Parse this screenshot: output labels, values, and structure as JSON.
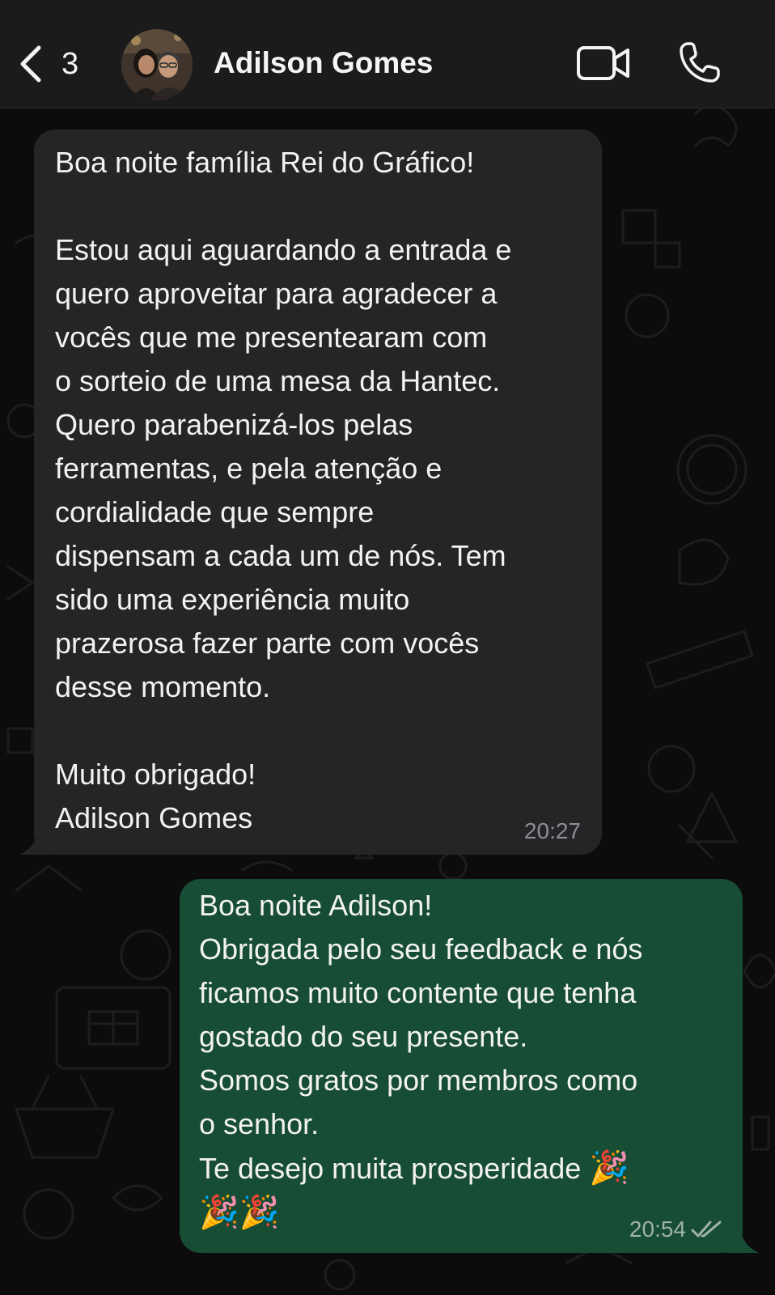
{
  "header": {
    "back_count": "3",
    "contact_name": "Adilson Gomes"
  },
  "messages": [
    {
      "direction": "incoming",
      "text": "Boa noite família Rei do Gráfico!\n\nEstou aqui aguardando a entrada e\nquero aproveitar para agradecer a\nvocês que me presentearam com\no sorteio de uma mesa da Hantec.\nQuero parabenizá-los pelas\nferramentas, e pela atenção e\ncordialidade que sempre\ndispensam a cada um de nós. Tem\nsido uma experiência muito\nprazerosa fazer parte com vocês\ndesse momento.\n\nMuito obrigado!\nAdilson Gomes",
      "time": "20:27"
    },
    {
      "direction": "outgoing",
      "text": "Boa noite Adilson!\nObrigada pelo seu feedback e nós\nficamos muito contente que tenha\ngostado do seu presente.\nSomos gratos por membros como\no senhor.\nTe desejo muita prosperidade",
      "emoji": [
        "🎉",
        "🎉",
        "🎉"
      ],
      "time": "20:54",
      "status": "read"
    }
  ],
  "icons": {
    "back": "chevron-left-icon",
    "video": "video-camera-icon",
    "call": "phone-icon",
    "read": "double-check-icon"
  },
  "colors": {
    "header_bg": "#1b1b1b",
    "chat_bg": "#0c0c0c",
    "incoming_bubble": "#252527",
    "outgoing_bubble": "#174c35"
  }
}
